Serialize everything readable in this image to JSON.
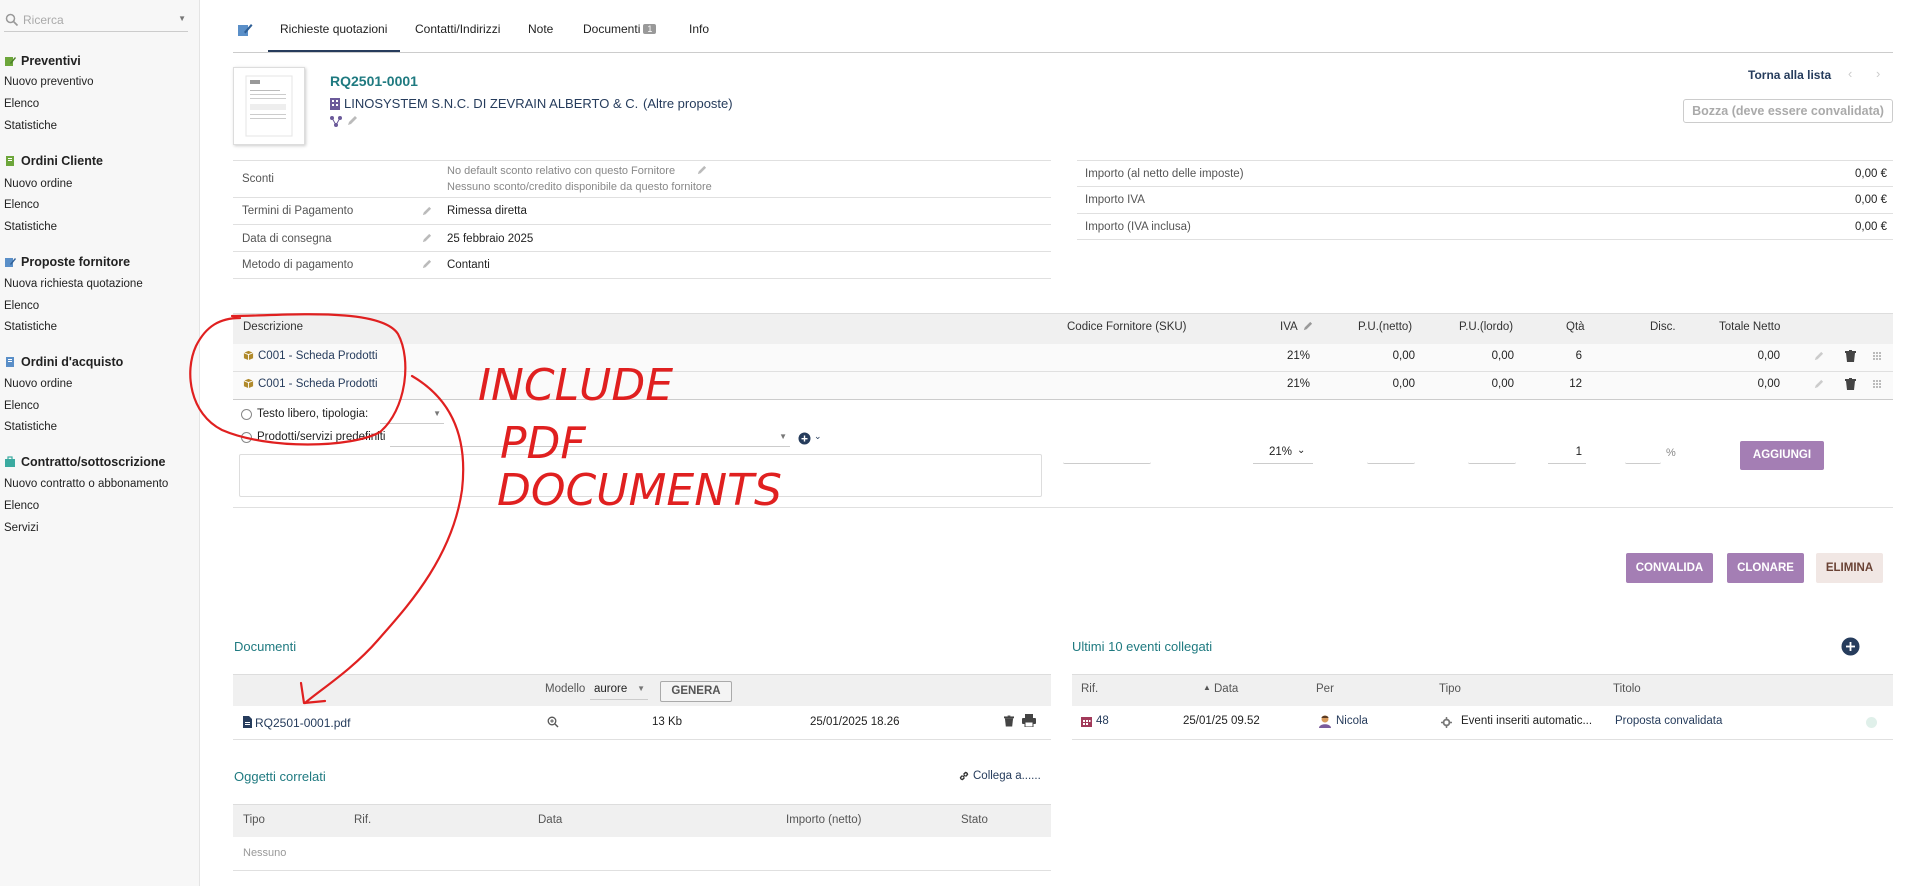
{
  "sidebar": {
    "search_placeholder": "Ricerca",
    "sections": [
      {
        "title": "Preventivi",
        "items": [
          "Nuovo preventivo",
          "Elenco",
          "Statistiche"
        ]
      },
      {
        "title": "Ordini Cliente",
        "items": [
          "Nuovo ordine",
          "Elenco",
          "Statistiche"
        ]
      },
      {
        "title": "Proposte fornitore",
        "items": [
          "Nuova richiesta quotazione",
          "Elenco",
          "Statistiche"
        ]
      },
      {
        "title": "Ordini d'acquisto",
        "items": [
          "Nuovo ordine",
          "Elenco",
          "Statistiche"
        ]
      },
      {
        "title": "Contratto/sottoscrizione",
        "items": [
          "Nuovo contratto o abbonamento",
          "Elenco",
          "Servizi"
        ]
      }
    ]
  },
  "tabs": [
    {
      "label": "Richieste quotazioni"
    },
    {
      "label": "Contatti/Indirizzi"
    },
    {
      "label": "Note"
    },
    {
      "label": "Documenti",
      "badge": "1"
    },
    {
      "label": "Info"
    }
  ],
  "header": {
    "ref": "RQ2501-0001",
    "supplier": "LINOSYSTEM S.N.C. DI ZEVRAIN ALBERTO & C.",
    "other_proposals": "(Altre proposte)",
    "back_to_list": "Torna alla lista",
    "status": "Bozza (deve essere convalidata)"
  },
  "info": {
    "discounts_label": "Sconti",
    "discounts_line1": "No default sconto relativo con questo Fornitore",
    "discounts_line2": "Nessuno sconto/credito disponibile da questo fornitore",
    "payment_terms_label": "Termini di Pagamento",
    "payment_terms_value": "Rimessa diretta",
    "delivery_label": "Data di consegna",
    "delivery_value": "25 febbraio 2025",
    "payment_method_label": "Metodo di pagamento",
    "payment_method_value": "Contanti"
  },
  "totals": [
    {
      "label": "Importo (al netto delle imposte)",
      "value": "0,00 €"
    },
    {
      "label": "Importo IVA",
      "value": "0,00 €"
    },
    {
      "label": "Importo (IVA inclusa)",
      "value": "0,00 €"
    }
  ],
  "lines": {
    "headers": {
      "desc": "Descrizione",
      "sku": "Codice Fornitore (SKU)",
      "vat": "IVA",
      "pu_net": "P.U.(netto)",
      "pu_gross": "P.U.(lordo)",
      "qty": "Qtà",
      "disc": "Disc.",
      "total": "Totale Netto"
    },
    "rows": [
      {
        "desc": "C001 - Scheda Prodotti",
        "vat": "21%",
        "pu_net": "0,00",
        "pu_gross": "0,00",
        "qty": "6",
        "total": "0,00"
      },
      {
        "desc": "C001 - Scheda Prodotti",
        "vat": "21%",
        "pu_net": "0,00",
        "pu_gross": "0,00",
        "qty": "12",
        "total": "0,00"
      }
    ],
    "free_text_label": "Testo libero, tipologia:",
    "predefined_label": "Prodotti/servizi predefiniti",
    "vat_select": "21%",
    "qty_default": "1",
    "pct": "%",
    "add_button": "AGGIUNGI"
  },
  "actions": {
    "validate": "CONVALIDA",
    "clone": "CLONARE",
    "delete": "ELIMINA"
  },
  "documents": {
    "title": "Documenti",
    "model_label": "Modello",
    "model_value": "aurore",
    "generate": "GENERA",
    "file_name": "RQ2501-0001.pdf",
    "size": "13 Kb",
    "date": "25/01/2025 18.26"
  },
  "related": {
    "title": "Oggetti correlati",
    "link": "Collega a......",
    "headers": [
      "Tipo",
      "Rif.",
      "Data",
      "Importo (netto)",
      "Stato"
    ],
    "empty": "Nessuno"
  },
  "events": {
    "title": "Ultimi 10 eventi collegati",
    "headers": [
      "Rif.",
      "Data",
      "Per",
      "Tipo",
      "Titolo"
    ],
    "row": {
      "ref": "48",
      "date": "25/01/25 09.52",
      "user": "Nicola",
      "type": "Eventi inseriti automatic...",
      "title": "Proposta convalidata"
    }
  },
  "annotation": {
    "line1": "INCLUDE",
    "line2": "PDF",
    "line3": "DOCUMENTS"
  },
  "colors": {
    "accent": "#a47eb4",
    "teal": "#1f7a80",
    "navy": "#263c5c",
    "annotation": "#e02020"
  }
}
